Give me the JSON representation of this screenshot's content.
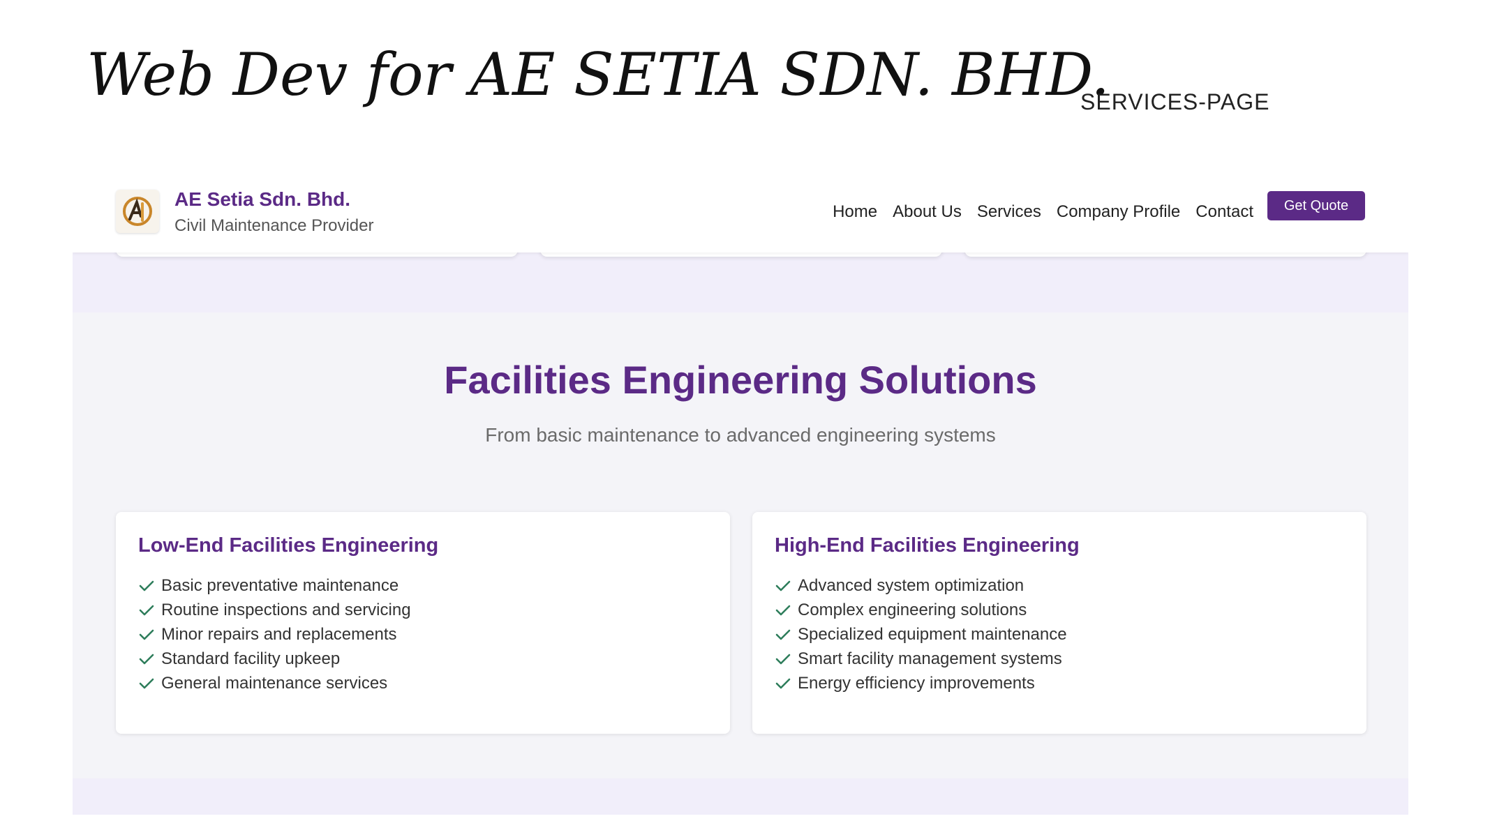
{
  "slide": {
    "title": "Web Dev for AE SETIA SDN. BHD.",
    "tag": "SERVICES-PAGE"
  },
  "site": {
    "brand_name": "AE Setia Sdn. Bhd.",
    "brand_sub": "Civil Maintenance Provider",
    "logo_icon": "ae-logo-icon",
    "nav": [
      "Home",
      "About Us",
      "Services",
      "Company Profile",
      "Contact"
    ],
    "cta_label": "Get Quote"
  },
  "section": {
    "title": "Facilities Engineering Solutions",
    "subtitle": "From basic maintenance to advanced engineering systems"
  },
  "cards": [
    {
      "title": "Low-End Facilities Engineering",
      "items": [
        "Basic preventative maintenance",
        "Routine inspections and servicing",
        "Minor repairs and replacements",
        "Standard facility upkeep",
        "General maintenance services"
      ]
    },
    {
      "title": "High-End Facilities Engineering",
      "items": [
        "Advanced system optimization",
        "Complex engineering solutions",
        "Specialized equipment maintenance",
        "Smart facility management systems",
        "Energy efficiency improvements"
      ]
    }
  ],
  "colors": {
    "brand": "#5b2a86",
    "check": "#2e7d5b",
    "band": "#f1eefa",
    "section_bg": "#f4f4f8"
  }
}
